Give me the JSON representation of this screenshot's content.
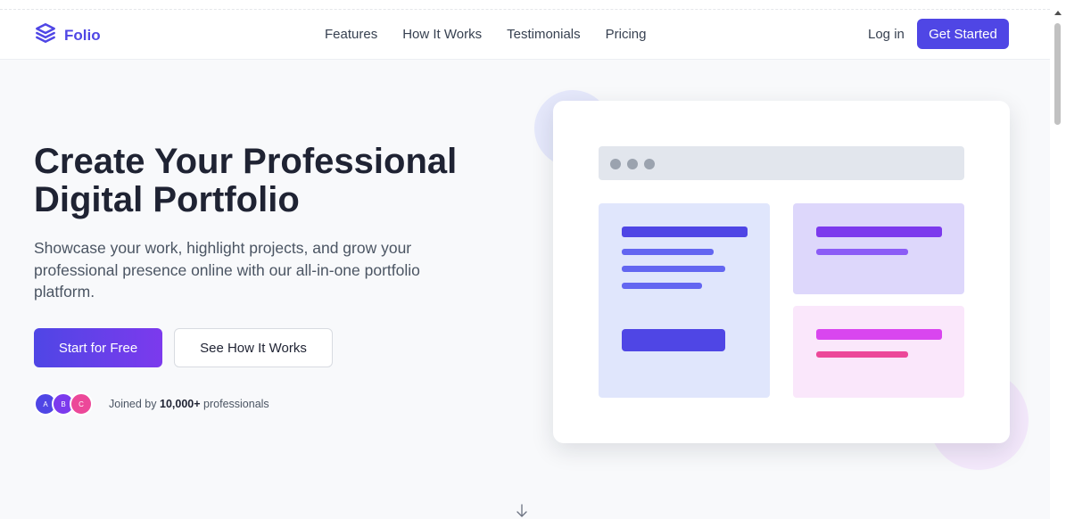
{
  "header": {
    "logo_text": "Folio",
    "logo_icon": "layers-icon",
    "nav": [
      "Features",
      "How It Works",
      "Testimonials",
      "Pricing"
    ],
    "login_label": "Log in",
    "cta_label": "Get Started"
  },
  "hero": {
    "title_line1": "Create Your Professional",
    "title_line2": "Digital Portfolio",
    "subtitle_line1": "Showcase your work, highlight projects, and grow your",
    "subtitle_line2": "professional presence online with our all-in-one portfolio",
    "subtitle_line3": "platform.",
    "primary_button": "Start for Free",
    "secondary_button": "See How It Works",
    "avatars": [
      {
        "initial": "A",
        "color": "#4f46e5"
      },
      {
        "initial": "B",
        "color": "#7c3aed"
      },
      {
        "initial": "C",
        "color": "#ec4899"
      }
    ],
    "joined_prefix": "Joined by",
    "joined_count": "10,000+",
    "joined_suffix": "professionals"
  },
  "colors": {
    "accent": "#4f46e5",
    "accent_purple": "#7c3aed",
    "accent_pink": "#ec4899",
    "background": "#f8f9fb"
  },
  "icons": {
    "scroll_indicator": "arrow-down-icon"
  }
}
